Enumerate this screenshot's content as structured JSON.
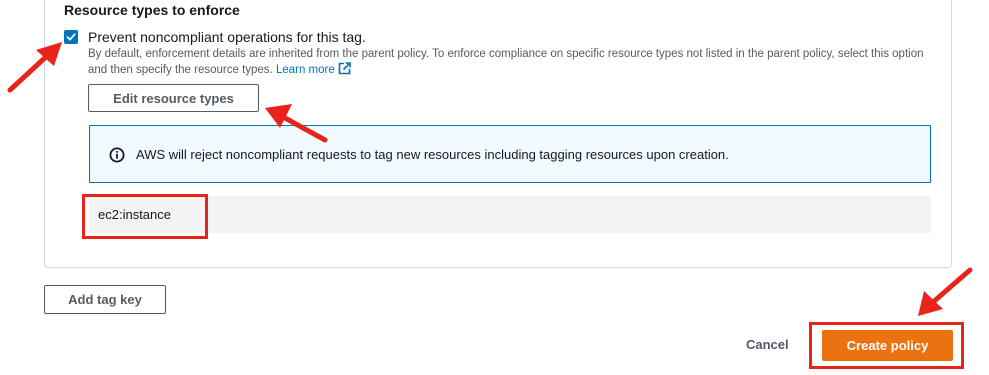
{
  "section": {
    "title": "Resource types to enforce"
  },
  "checkbox": {
    "checked": true,
    "label": "Prevent noncompliant operations for this tag.",
    "description": "By default, enforcement details are inherited from the parent policy. To enforce compliance on specific resource types not listed in the parent policy, select this option and then specify the resource types.",
    "learn_more": "Learn more",
    "learn_more_icon": "external-link-icon"
  },
  "edit_button": {
    "label": "Edit resource types"
  },
  "info_alert": {
    "icon": "info-icon",
    "text": "AWS will reject noncompliant requests to tag new resources including tagging resources upon creation."
  },
  "resource_types": [
    "ec2:instance"
  ],
  "add_tag_key_button": {
    "label": "Add tag key"
  },
  "footer": {
    "cancel_label": "Cancel",
    "create_label": "Create policy"
  },
  "colors": {
    "primary_button": "#ec7211",
    "link": "#0073bb",
    "checkbox": "#0073bb",
    "info_border": "#0073bb",
    "info_background": "#f1faff",
    "annotation": "#e8241a"
  }
}
